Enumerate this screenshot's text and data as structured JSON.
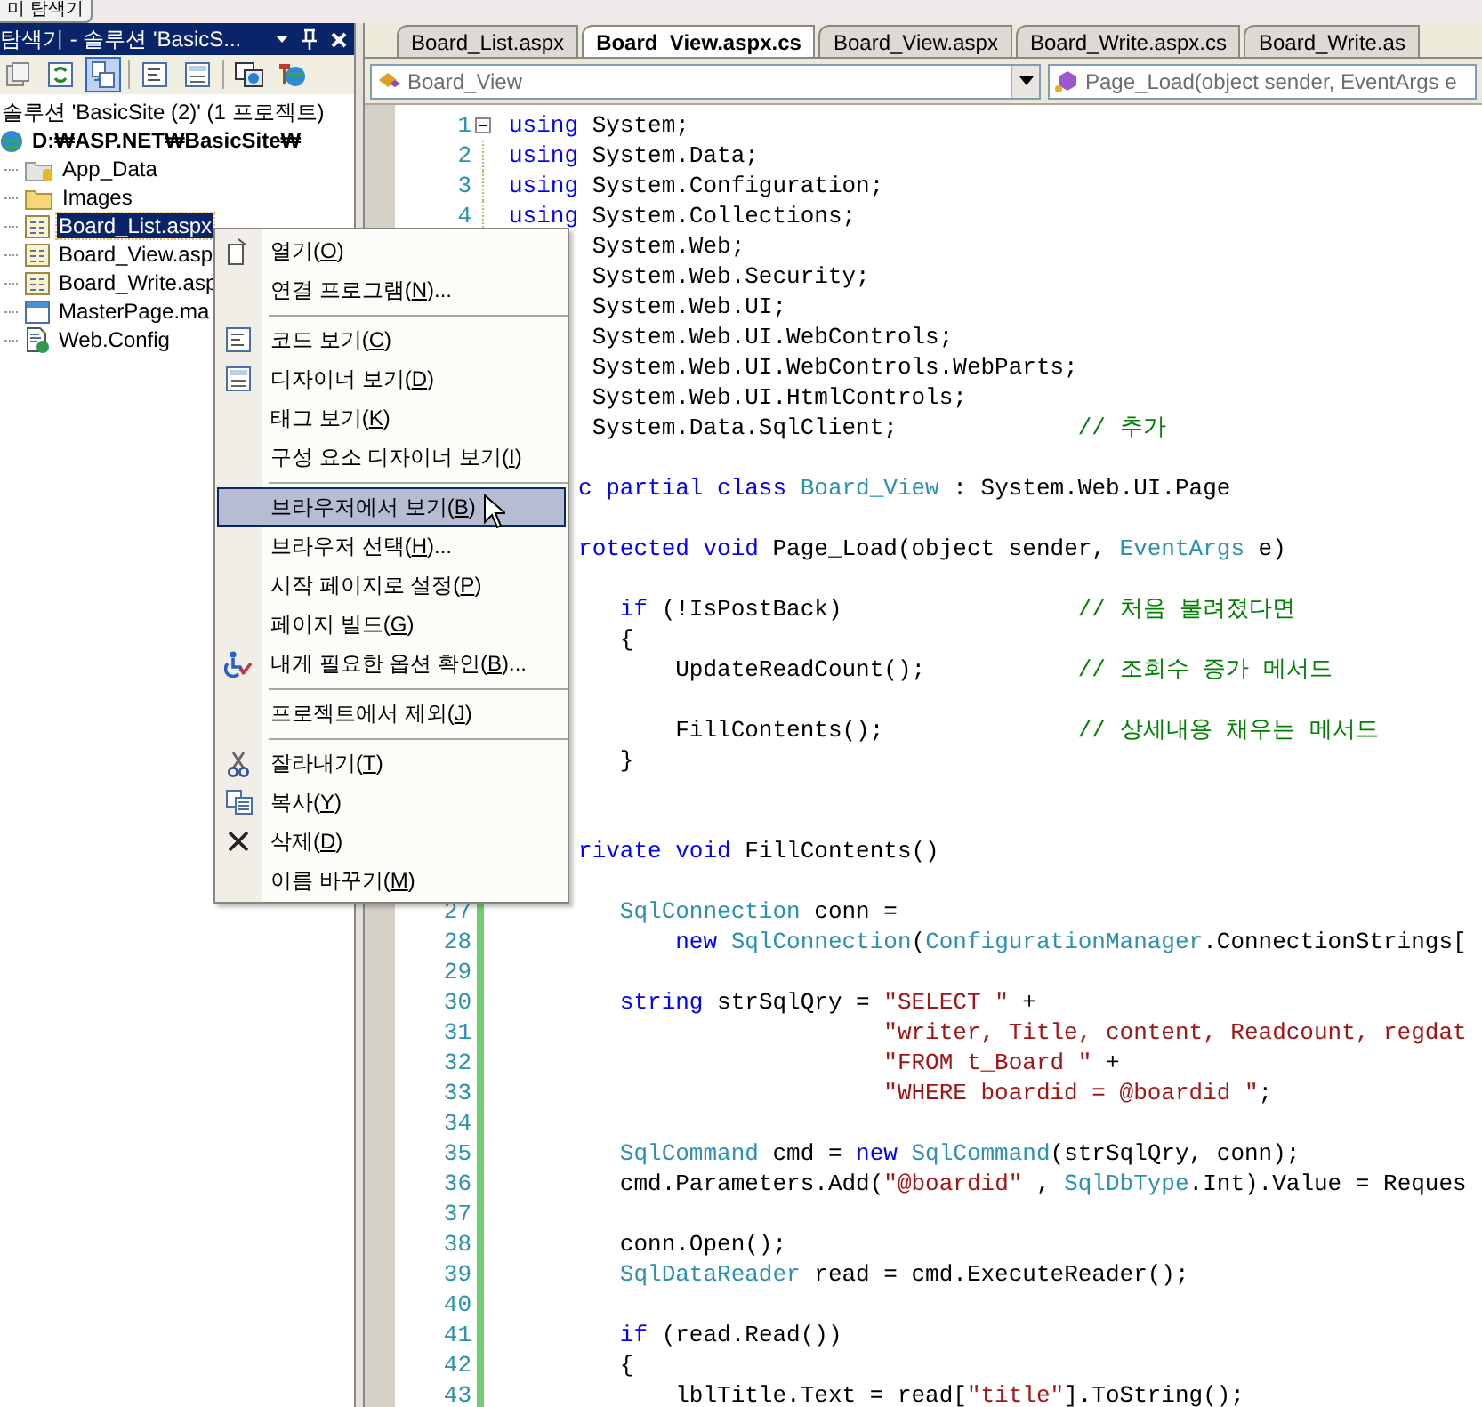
{
  "top_tab": "미 탐색기",
  "explorer": {
    "title": "탐색기 - 솔루션 'BasicS...",
    "toolbar": [
      {
        "kind": "properties",
        "pressed": false
      },
      {
        "kind": "refresh",
        "pressed": false
      },
      {
        "kind": "show-all",
        "pressed": true
      },
      {
        "kind": "separator"
      },
      {
        "kind": "view-code",
        "pressed": false
      },
      {
        "kind": "view-designer",
        "pressed": false
      },
      {
        "kind": "separator"
      },
      {
        "kind": "copy-site",
        "pressed": false
      },
      {
        "kind": "config",
        "pressed": false
      }
    ],
    "tree": [
      {
        "label": "솔루션 'BasicSite (2)' (1 프로젝트)",
        "kind": "solution",
        "selected": false,
        "children": [
          {
            "label": "D:₩ASP.NET₩BasicSite₩",
            "kind": "project",
            "selected": false,
            "children": [
              {
                "label": "App_Data",
                "kind": "data-folder",
                "selected": false
              },
              {
                "label": "Images",
                "kind": "folder",
                "selected": false
              },
              {
                "label": "Board_List.aspx",
                "kind": "page",
                "selected": true
              },
              {
                "label": "Board_View.asp",
                "kind": "page",
                "selected": false
              },
              {
                "label": "Board_Write.asp",
                "kind": "page",
                "selected": false
              },
              {
                "label": "MasterPage.ma",
                "kind": "master",
                "selected": false
              },
              {
                "label": "Web.Config",
                "kind": "config",
                "selected": false
              }
            ]
          }
        ]
      }
    ]
  },
  "editor": {
    "tabs": [
      {
        "label": "Board_List.aspx",
        "selected": false
      },
      {
        "label": "Board_View.aspx.cs",
        "selected": true
      },
      {
        "label": "Board_View.aspx",
        "selected": false
      },
      {
        "label": "Board_Write.aspx.cs",
        "selected": false
      },
      {
        "label": "Board_Write.as",
        "selected": false
      }
    ],
    "class_dropdown": "Board_View",
    "member_dropdown": "Page_Load(object sender, EventArgs e",
    "lines": [
      {
        "kind": "code",
        "number": "1",
        "fold": true,
        "changed": false,
        "tokens": [
          {
            "kind": "keyword",
            "text": "using"
          },
          {
            "kind": "plain",
            "text": " System;"
          }
        ]
      },
      {
        "kind": "code",
        "number": "2",
        "fold": false,
        "changed": false,
        "tokens": [
          {
            "kind": "keyword",
            "text": "using"
          },
          {
            "kind": "plain",
            "text": " System.Data;"
          }
        ]
      },
      {
        "kind": "code",
        "number": "3",
        "fold": false,
        "changed": false,
        "tokens": [
          {
            "kind": "keyword",
            "text": "using"
          },
          {
            "kind": "plain",
            "text": " System.Configuration;"
          }
        ]
      },
      {
        "kind": "code",
        "number": "4",
        "fold": false,
        "changed": false,
        "tokens": [
          {
            "kind": "keyword",
            "text": "using"
          },
          {
            "kind": "plain",
            "text": " System.Collections;"
          }
        ]
      },
      {
        "kind": "code",
        "tokens": [
          {
            "kind": "plain",
            "text": "      System.Web;"
          }
        ]
      },
      {
        "kind": "code",
        "tokens": [
          {
            "kind": "plain",
            "text": "      System.Web.Security;"
          }
        ]
      },
      {
        "kind": "code",
        "tokens": [
          {
            "kind": "plain",
            "text": "      System.Web.UI;"
          }
        ]
      },
      {
        "kind": "code",
        "tokens": [
          {
            "kind": "plain",
            "text": "      System.Web.UI.WebControls;"
          }
        ]
      },
      {
        "kind": "code",
        "tokens": [
          {
            "kind": "plain",
            "text": "      System.Web.UI.WebControls.WebParts;"
          }
        ]
      },
      {
        "kind": "code",
        "tokens": [
          {
            "kind": "plain",
            "text": "      System.Web.UI.HtmlControls;"
          }
        ]
      },
      {
        "kind": "code",
        "tokens": [
          {
            "kind": "plain",
            "text": "      System.Data.SqlClient;             "
          },
          {
            "kind": "comment",
            "text": "// 추가"
          }
        ]
      },
      {
        "kind": "blank"
      },
      {
        "kind": "code",
        "tokens": [
          {
            "kind": "keyword",
            "text": "     c partial class"
          },
          {
            "kind": "type",
            "text": " Board_View"
          },
          {
            "kind": "plain",
            "text": " : System.Web.UI.Page"
          }
        ]
      },
      {
        "kind": "blank"
      },
      {
        "kind": "code",
        "tokens": [
          {
            "kind": "keyword",
            "text": "     rotected void"
          },
          {
            "kind": "plain",
            "text": " Page_Load(object sender, "
          },
          {
            "kind": "type",
            "text": "EventArgs"
          },
          {
            "kind": "plain",
            "text": " e)"
          }
        ]
      },
      {
        "kind": "blank"
      },
      {
        "kind": "code",
        "tokens": [
          {
            "kind": "keyword",
            "text": "        if"
          },
          {
            "kind": "plain",
            "text": " (!IsPostBack)                 "
          },
          {
            "kind": "comment",
            "text": "// 처음 불려졌다면"
          }
        ]
      },
      {
        "kind": "code",
        "tokens": [
          {
            "kind": "plain",
            "text": "        {"
          }
        ]
      },
      {
        "kind": "code",
        "tokens": [
          {
            "kind": "plain",
            "text": "            UpdateReadCount();           "
          },
          {
            "kind": "comment",
            "text": "// 조회수 증가 메서드"
          }
        ]
      },
      {
        "kind": "blank"
      },
      {
        "kind": "code",
        "tokens": [
          {
            "kind": "plain",
            "text": "            FillContents();              "
          },
          {
            "kind": "comment",
            "text": "// 상세내용 채우는 메서드"
          }
        ]
      },
      {
        "kind": "code",
        "tokens": [
          {
            "kind": "plain",
            "text": "        }"
          }
        ]
      },
      {
        "kind": "blank"
      },
      {
        "kind": "blank"
      },
      {
        "kind": "code",
        "tokens": [
          {
            "kind": "keyword",
            "text": "     rivate void"
          },
          {
            "kind": "plain",
            "text": " FillContents()"
          }
        ]
      },
      {
        "kind": "blank"
      },
      {
        "kind": "code",
        "number": "27",
        "fold": false,
        "changed": true,
        "tokens": [
          {
            "kind": "type",
            "text": "        SqlConnection"
          },
          {
            "kind": "plain",
            "text": " conn ="
          }
        ]
      },
      {
        "kind": "code",
        "number": "28",
        "fold": false,
        "changed": true,
        "tokens": [
          {
            "kind": "keyword",
            "text": "            new"
          },
          {
            "kind": "type",
            "text": " SqlConnection"
          },
          {
            "kind": "plain",
            "text": "("
          },
          {
            "kind": "type",
            "text": "ConfigurationManager"
          },
          {
            "kind": "plain",
            "text": ".ConnectionStrings["
          }
        ]
      },
      {
        "kind": "code",
        "number": "29",
        "fold": false,
        "changed": true
      },
      {
        "kind": "code",
        "number": "30",
        "fold": false,
        "changed": true,
        "tokens": [
          {
            "kind": "keyword",
            "text": "        string"
          },
          {
            "kind": "plain",
            "text": " strSqlQry = "
          },
          {
            "kind": "string",
            "text": "\"SELECT \""
          },
          {
            "kind": "plain",
            "text": " +"
          }
        ]
      },
      {
        "kind": "code",
        "number": "31",
        "fold": false,
        "changed": true,
        "tokens": [
          {
            "kind": "string",
            "text": "                           \"writer, Title, content, Readcount, regdat"
          }
        ]
      },
      {
        "kind": "code",
        "number": "32",
        "fold": false,
        "changed": true,
        "tokens": [
          {
            "kind": "string",
            "text": "                           \"FROM t_Board \""
          },
          {
            "kind": "plain",
            "text": " +"
          }
        ]
      },
      {
        "kind": "code",
        "number": "33",
        "fold": false,
        "changed": true,
        "tokens": [
          {
            "kind": "string",
            "text": "                           \"WHERE boardid = @boardid \""
          },
          {
            "kind": "plain",
            "text": ";"
          }
        ]
      },
      {
        "kind": "code",
        "number": "34",
        "fold": false,
        "changed": true
      },
      {
        "kind": "code",
        "number": "35",
        "fold": false,
        "changed": true,
        "tokens": [
          {
            "kind": "type",
            "text": "        SqlCommand"
          },
          {
            "kind": "plain",
            "text": " cmd = "
          },
          {
            "kind": "keyword",
            "text": "new"
          },
          {
            "kind": "type",
            "text": " SqlCommand"
          },
          {
            "kind": "plain",
            "text": "(strSqlQry, conn);"
          }
        ]
      },
      {
        "kind": "code",
        "number": "36",
        "fold": false,
        "changed": true,
        "tokens": [
          {
            "kind": "plain",
            "text": "        cmd.Parameters.Add("
          },
          {
            "kind": "string",
            "text": "\"@boardid\""
          },
          {
            "kind": "plain",
            "text": " , "
          },
          {
            "kind": "type",
            "text": "SqlDbType"
          },
          {
            "kind": "plain",
            "text": ".Int).Value = Reques"
          }
        ]
      },
      {
        "kind": "code",
        "number": "37",
        "fold": false,
        "changed": true
      },
      {
        "kind": "code",
        "number": "38",
        "fold": false,
        "changed": true,
        "tokens": [
          {
            "kind": "plain",
            "text": "        conn.Open();"
          }
        ]
      },
      {
        "kind": "code",
        "number": "39",
        "fold": false,
        "changed": true,
        "tokens": [
          {
            "kind": "type",
            "text": "        SqlDataReader"
          },
          {
            "kind": "plain",
            "text": " read = cmd.ExecuteReader();"
          }
        ]
      },
      {
        "kind": "code",
        "number": "40",
        "fold": false,
        "changed": true
      },
      {
        "kind": "code",
        "number": "41",
        "fold": false,
        "changed": true,
        "tokens": [
          {
            "kind": "keyword",
            "text": "        if"
          },
          {
            "kind": "plain",
            "text": " (read.Read())"
          }
        ]
      },
      {
        "kind": "code",
        "number": "42",
        "fold": false,
        "changed": true,
        "tokens": [
          {
            "kind": "plain",
            "text": "        {"
          }
        ]
      },
      {
        "kind": "code",
        "number": "43",
        "fold": false,
        "changed": true,
        "tokens": [
          {
            "kind": "plain",
            "text": "            lblTitle.Text = read["
          },
          {
            "kind": "string",
            "text": "\"title\""
          },
          {
            "kind": "plain",
            "text": "].ToString();"
          }
        ]
      }
    ]
  },
  "context_menu": {
    "items": [
      {
        "kind": "open",
        "text": "열기(",
        "key": "O",
        "after": ")",
        "selected": false
      },
      {
        "kind": "plain",
        "text": "연결 프로그램(",
        "key": "N",
        "after": ")...",
        "selected": false
      },
      {
        "kind": "separator"
      },
      {
        "kind": "code",
        "text": "코드 보기(",
        "key": "C",
        "after": ")",
        "selected": false
      },
      {
        "kind": "designer",
        "text": "디자이너 보기(",
        "key": "D",
        "after": ")",
        "selected": false
      },
      {
        "kind": "plain",
        "text": "태그 보기(",
        "key": "K",
        "after": ")",
        "selected": false
      },
      {
        "kind": "plain",
        "text": "구성 요소 디자이너 보기(",
        "key": "I",
        "after": ")",
        "selected": false
      },
      {
        "kind": "separator"
      },
      {
        "kind": "browser",
        "text": "브라우저에서 보기(",
        "key": "B",
        "after": ")",
        "selected": true
      },
      {
        "kind": "plain",
        "text": "브라우저 선택(",
        "key": "H",
        "after": ")...",
        "selected": false
      },
      {
        "kind": "plain",
        "text": "시작 페이지로 설정(",
        "key": "P",
        "after": ")",
        "selected": false
      },
      {
        "kind": "plain",
        "text": "페이지 빌드(",
        "key": "G",
        "after": ")",
        "selected": false
      },
      {
        "kind": "accessibility",
        "text": "내게 필요한 옵션 확인(",
        "key": "B",
        "after": ")...",
        "selected": false
      },
      {
        "kind": "separator"
      },
      {
        "kind": "plain",
        "text": "프로젝트에서 제외(",
        "key": "J",
        "after": ")",
        "selected": false
      },
      {
        "kind": "separator"
      },
      {
        "kind": "cut",
        "text": "잘라내기(",
        "key": "T",
        "after": ")",
        "selected": false
      },
      {
        "kind": "copy",
        "text": "복사(",
        "key": "Y",
        "after": ")",
        "selected": false
      },
      {
        "kind": "delete",
        "text": "삭제(",
        "key": "D",
        "after": ")",
        "selected": false
      },
      {
        "kind": "plain",
        "text": "이름 바꾸기(",
        "key": "M",
        "after": ")",
        "selected": false
      }
    ]
  }
}
